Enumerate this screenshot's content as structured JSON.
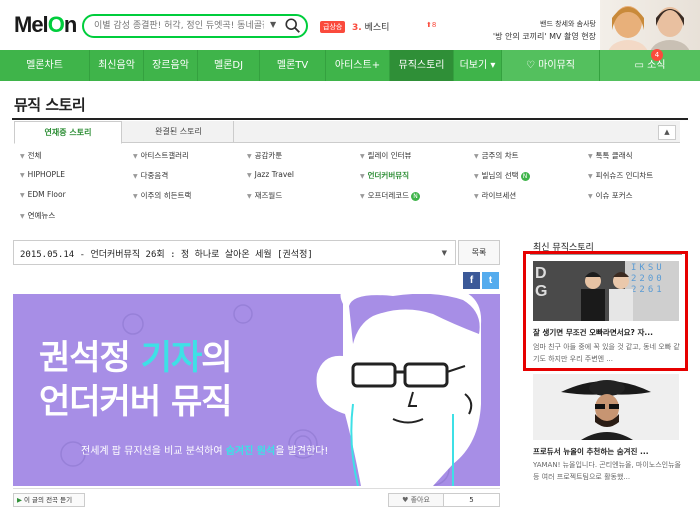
{
  "colors": {
    "brand_green": "#3fb44a",
    "accent_red": "#fa4a3c",
    "banner_purple": "#a78ee6",
    "banner_cyan": "#3ee0e6",
    "highlight_red": "#e60000"
  },
  "header": {
    "logo": {
      "main": "Mel",
      "accent": "n",
      "accent_glyph": "O"
    },
    "search": {
      "placeholder": "이별 감성 종결판! 허각, 정인 듀엣곡! 동네골잡",
      "icon": "search-icon",
      "dropdown_icon": "caret-down-icon"
    },
    "realtime": {
      "badge": "급상승",
      "rank": "3.",
      "keyword": "베스티",
      "change": "8"
    },
    "promo": {
      "line1": "밴드 창세와 솜사탕",
      "line2": "'방 안의 코끼리' MV 촬영 현장"
    }
  },
  "nav": {
    "items": [
      "멜론차트",
      "최신음악",
      "장르음악",
      "멜론DJ",
      "멜론TV",
      "아티스트+",
      "뮤직스토리",
      "더보기"
    ],
    "more_caret": "▾",
    "my_music": "마이뮤직",
    "social": "소식",
    "social_badge": "4"
  },
  "page": {
    "title": "뮤직 스토리",
    "tabs": [
      "연재중 스토리",
      "완결된 스토리"
    ],
    "toggle_icon": "chevron-up-icon",
    "categories": [
      {
        "label": "전체"
      },
      {
        "label": "아티스트갤러리"
      },
      {
        "label": "공감카툰"
      },
      {
        "label": "릴레이 인터뷰"
      },
      {
        "label": "금주의 차트"
      },
      {
        "label": "톡톡 클래식"
      },
      {
        "label": "HIPHOPLE"
      },
      {
        "label": "다중음격"
      },
      {
        "label": "Jazz Travel"
      },
      {
        "label": "언더커버뮤직",
        "active": true
      },
      {
        "label": "빌님의 선택",
        "new": "N"
      },
      {
        "label": "피쉬슈즈 인디차트"
      },
      {
        "label": "EDM Floor"
      },
      {
        "label": "이주의 히든트랙"
      },
      {
        "label": "재즈월드"
      },
      {
        "label": "오프더레코드",
        "new": "N"
      },
      {
        "label": "라이브세션"
      },
      {
        "label": "이슈 포커스"
      },
      {
        "label": "연예뉴스"
      }
    ]
  },
  "article": {
    "selector": "2015.05.14 - 언더커버뮤직 26회 : 정 하나로 살아온 세월 [권석정]",
    "list_button": "목록",
    "share": {
      "facebook": "f",
      "twitter": "t"
    },
    "banner": {
      "line1_white": "권석정 ",
      "line1_accent": "기자",
      "line1_rest": "의",
      "line2": "언더커버 뮤직",
      "sub_pre": "전세계 팝 뮤지션을 비교 분석하여 ",
      "sub_accent": "숨겨진 원석",
      "sub_post": "을 발견한다!"
    },
    "full_view": "이 글의 전곡 듣기",
    "like_label": "좋아요",
    "like_count": "5"
  },
  "sidebar": {
    "title": "최신 뮤직스토리",
    "cards": [
      {
        "img_text_left": "D\nG",
        "img_text_right": "IKSU\n2200\n2261",
        "title": "잘 생기면 무조건 오빠라면서요? 자...",
        "desc": "엄마 친구 아들 중에 꼭 있을 것 같고, 동네 오빠 같기도 하지만 우리 주변엔 ..."
      },
      {
        "title": "프로듀서 뉴올이 추천하는 숨겨진 ...",
        "desc": "YAMAN! 뉴올입니다. 곤티엔뉴올, 마이노스인뉴올등 여러 프로젝트팀으로 활동했..."
      }
    ]
  }
}
